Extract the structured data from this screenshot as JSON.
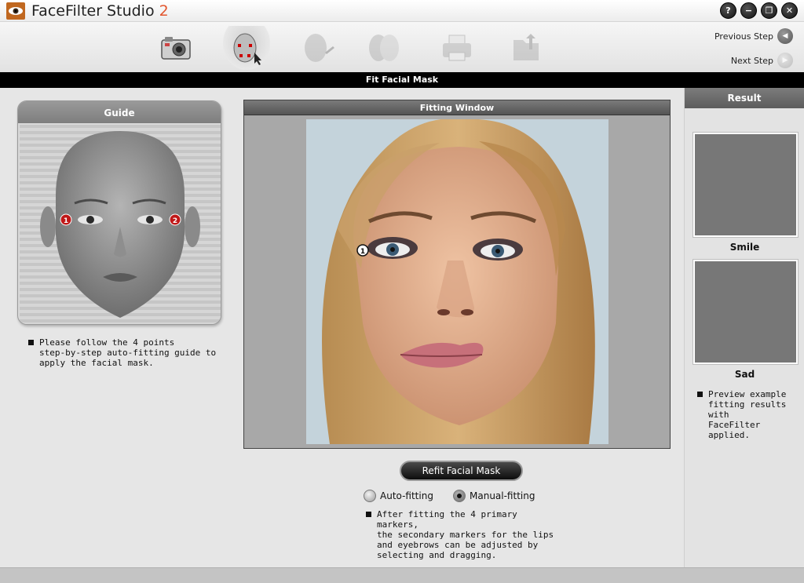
{
  "app": {
    "title": "FaceFilter Studio",
    "version": "2",
    "window_buttons": [
      {
        "name": "help-button",
        "glyph": "?"
      },
      {
        "name": "minimize-button",
        "glyph": "−"
      },
      {
        "name": "restore-button",
        "glyph": "❐"
      },
      {
        "name": "close-button",
        "glyph": "✕"
      }
    ]
  },
  "toolbar": {
    "tools": [
      {
        "icon": "camera-icon",
        "state": "normal"
      },
      {
        "icon": "fit-mask-icon",
        "state": "active"
      },
      {
        "icon": "face-edit-icon",
        "state": "disabled"
      },
      {
        "icon": "face-compare-icon",
        "state": "disabled"
      },
      {
        "icon": "printer-icon",
        "state": "disabled"
      },
      {
        "icon": "save-folder-icon",
        "state": "disabled"
      }
    ],
    "previous_step": "Previous Step",
    "next_step": "Next Step"
  },
  "step_title": "Fit Facial Mask",
  "guide": {
    "title": "Guide",
    "markers": [
      "1",
      "2"
    ],
    "note": "Please follow the 4 points\nstep-by-step auto-fitting guide to\napply the facial mask."
  },
  "fitting": {
    "title": "Fitting Window",
    "marker": "1",
    "refit_button": "Refit Facial Mask",
    "options": [
      {
        "label": "Auto-fitting",
        "checked": false
      },
      {
        "label": "Manual-fitting",
        "checked": true
      }
    ],
    "note": "After fitting the 4 primary markers,\nthe secondary markers for the lips\nand eyebrows can be adjusted by\nselecting and dragging."
  },
  "result": {
    "title": "Result",
    "previews": [
      "Smile",
      "Sad"
    ],
    "note": "Preview example\nfitting results with\nFaceFilter applied."
  }
}
